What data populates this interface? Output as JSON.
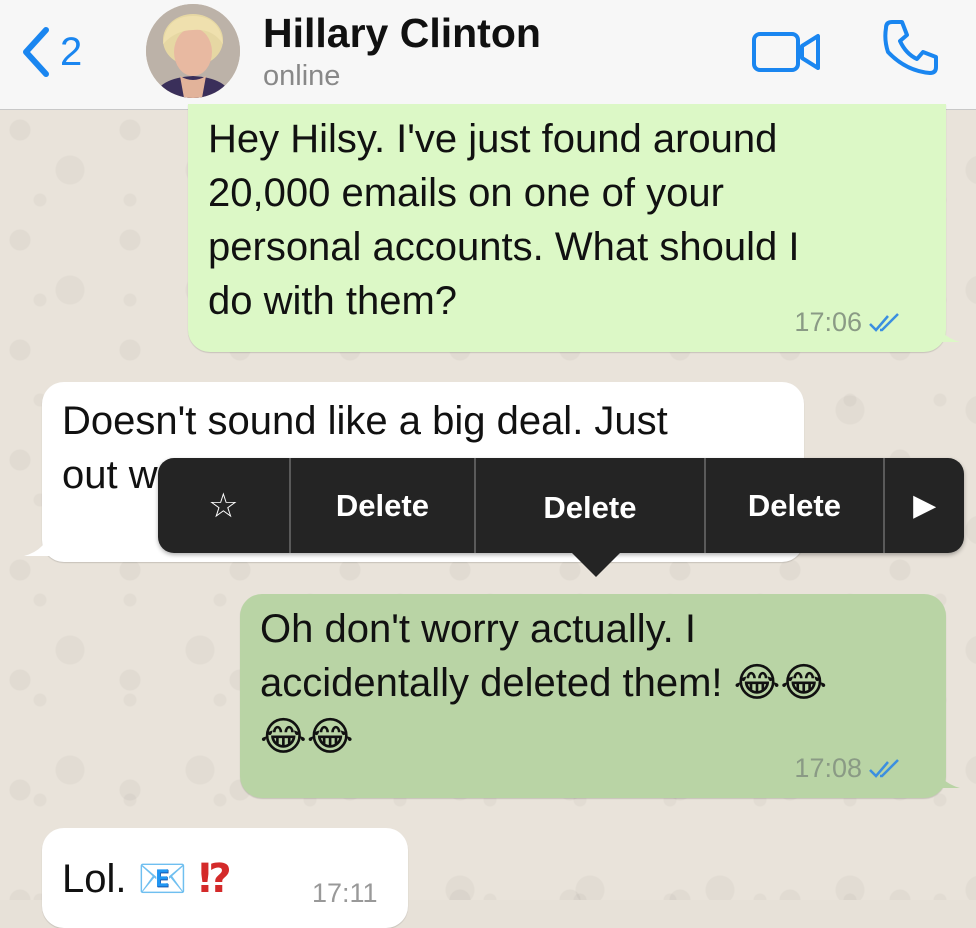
{
  "header": {
    "back_count": "2",
    "contact_name": "Hillary Clinton",
    "contact_status": "online",
    "icons": [
      "chevron-left-icon",
      "video-camera-icon",
      "phone-icon"
    ],
    "accent_color": "#1a86f0"
  },
  "messages": [
    {
      "direction": "outgoing",
      "lines": [
        "Hey Hilsy. I've just found around",
        "20,000 emails on one of your",
        "personal accounts. What should I",
        "do with them?"
      ],
      "time": "17:06",
      "status": "read"
    },
    {
      "direction": "incoming",
      "lines": [
        "Doesn't sound like a big deal. Just",
        "out w"
      ],
      "time": ""
    },
    {
      "direction": "outgoing",
      "lines": [
        "Oh don't worry actually. I",
        "accidentally deleted them!"
      ],
      "emoji_line": "😂😂",
      "trailing_emoji": "😂😂",
      "time": "17:08",
      "status": "read"
    },
    {
      "direction": "incoming",
      "text": "Lol.",
      "emoji": "📧",
      "interrobang": "⁉",
      "time": "17:11"
    }
  ],
  "context_menu": {
    "star": "☆",
    "items": [
      "Delete",
      "Delete",
      "Delete"
    ],
    "more": "▶"
  },
  "colors": {
    "outgoing_bubble": "#dcf8c6",
    "outgoing_selected": "#b9d4a5",
    "incoming_bubble": "#ffffff",
    "menu_background": "#242424",
    "read_ticks": "#3b8fe0"
  }
}
